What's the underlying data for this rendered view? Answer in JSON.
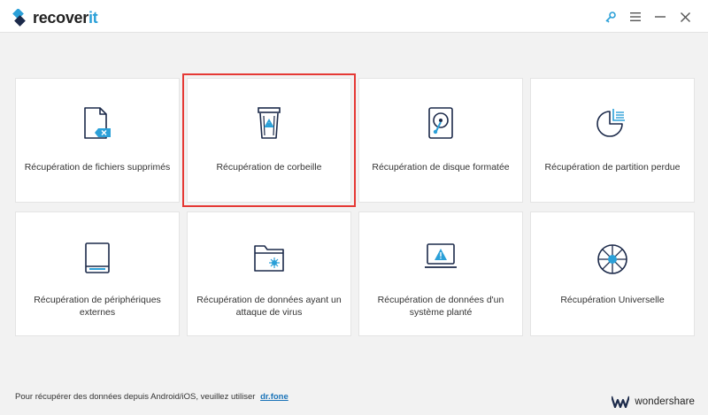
{
  "app": {
    "logo_text": "recover",
    "logo_accent": "it",
    "brand_color": "#2ba0d8"
  },
  "window_controls": [
    {
      "name": "key-icon"
    },
    {
      "name": "menu-icon"
    },
    {
      "name": "minimize-icon"
    },
    {
      "name": "close-icon"
    }
  ],
  "cards": [
    {
      "label": "Récupération de fichiers supprimés",
      "icon": "deleted-file-icon",
      "selected": false
    },
    {
      "label": "Récupération de corbeille",
      "icon": "recycle-bin-icon",
      "selected": true
    },
    {
      "label": "Récupération de disque formatée",
      "icon": "hard-disk-icon",
      "selected": false
    },
    {
      "label": "Récupération de partition perdue",
      "icon": "partition-icon",
      "selected": false
    },
    {
      "label": "Récupération de périphériques externes",
      "icon": "external-device-icon",
      "selected": false
    },
    {
      "label": "Récupération de données ayant un attaque de virus",
      "icon": "virus-folder-icon",
      "selected": false
    },
    {
      "label": "Récupération de données d'un système planté",
      "icon": "crashed-system-icon",
      "selected": false
    },
    {
      "label": "Récupération Universelle",
      "icon": "universal-icon",
      "selected": false
    }
  ],
  "footer": {
    "note": "Pour récupérer des données depuis Android/iOS, veuillez utiliser",
    "link": "dr.fone"
  },
  "brand": {
    "name": "wondershare"
  },
  "colors": {
    "accent": "#2ba0d8",
    "selection": "#e53935",
    "background": "#f2f2f2"
  }
}
